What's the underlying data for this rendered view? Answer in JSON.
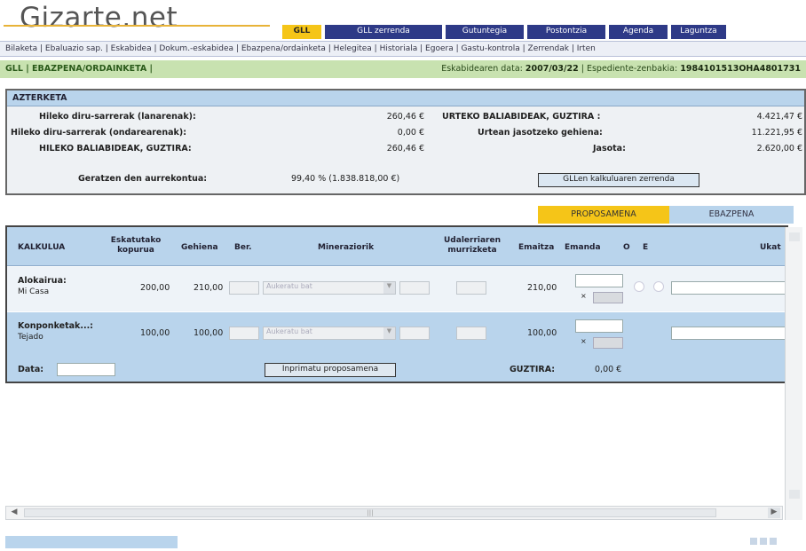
{
  "logo": "Gizarte.net",
  "tabs": [
    {
      "label": "GLL",
      "active": true
    },
    {
      "label": "GLL zerrenda",
      "active": false
    },
    {
      "label": "Gutuntegia",
      "active": false
    },
    {
      "label": "Postontzia",
      "active": false
    },
    {
      "label": "Agenda",
      "active": false
    },
    {
      "label": "Laguntza",
      "active": false
    }
  ],
  "subnav": "Bilaketa | Ebaluazio sap. | Eskabidea | Dokum.-eskabidea | Ebazpena/ordainketa | Helegitea | Historiala | Egoera | Gastu-kontrola | Zerrendak | Irten",
  "greenbar": {
    "left": "GLL | EBAZPENA/ORDAINKETA |",
    "date_label": "Eskabidearen data:",
    "date_value": "2007/03/22",
    "code_label": "| Espediente-zenbakia:",
    "code_value": "1984101513OHA4801731"
  },
  "azterketa": {
    "title": "AZTERKETA",
    "rows": [
      {
        "label": "Hileko diru-sarrerak (lanarenak):",
        "value": "260,46 €",
        "right_label": "URTEKO BALIABIDEAK, GUZTIRA :",
        "right_value": "4.421,47 €"
      },
      {
        "label": "Hileko diru-sarrerak (ondarearenak):",
        "value": "0,00 €",
        "right_label": "Urtean jasotzeko gehiena:",
        "right_value": "11.221,95 €"
      },
      {
        "label": "HILEKO BALIABIDEAK, GUZTIRA:",
        "value": "260,46 €",
        "right_label": "Jasota:",
        "right_value": "2.620,00 €"
      }
    ],
    "gastu_label": "Geratzen den aurrekontua:",
    "gastu_value": "99,40 % (1.838.818,00 €)",
    "calc_button": "GLLen kalkuluaren zerrenda"
  },
  "state_tabs": [
    {
      "label": "PROPOSAMENA",
      "active": true
    },
    {
      "label": "EBAZPENA",
      "active": false
    }
  ],
  "kalkulua": {
    "headers": {
      "kalkulua": "KALKULUA",
      "eskatutako": "Eskatutako kopurua",
      "gehiena": "Gehiena",
      "ber": "Ber.",
      "mineraziorik": "Mineraziorik",
      "udalerria": "Udalerriaren murrizketa",
      "emaitza": "Emaitza",
      "emanda": "Emanda",
      "o": "O",
      "e": "E",
      "ukat": "Ukat"
    },
    "rows": [
      {
        "title": "Alokairua:",
        "sub": "Mi Casa",
        "eskatutako": "200,00",
        "gehiena": "210,00",
        "select": "Aukeratu bat",
        "emaitza": "210,00"
      },
      {
        "title": "Konponketak...:",
        "sub": "Tejado",
        "eskatutako": "100,00",
        "gehiena": "100,00",
        "select": "Aukeratu bat",
        "emaitza": "100,00"
      }
    ],
    "data_label": "Data:",
    "print_button": "Inprimatu proposamena",
    "guztira_label": "GUZTIRA:",
    "guztira_value": "0,00 €"
  },
  "colors": {
    "nav_blue": "#2e3a87",
    "accent_yellow": "#f5c518",
    "light_blue": "#b9d4ec",
    "green_bar": "#c8e2b0"
  }
}
